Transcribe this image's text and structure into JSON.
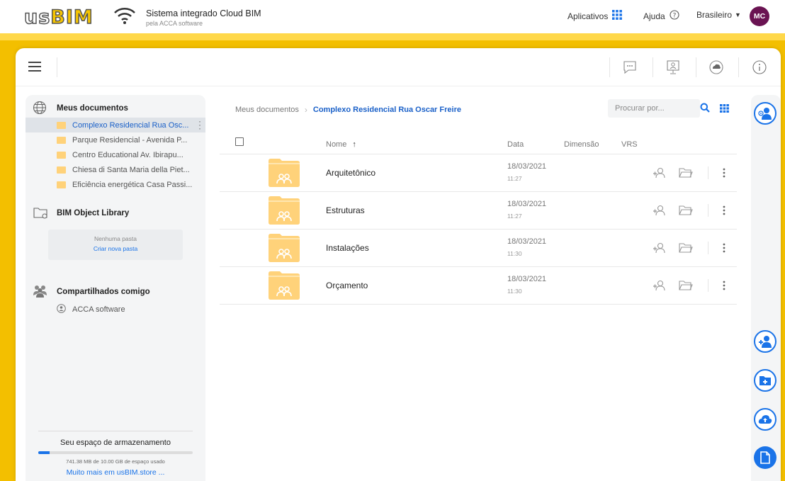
{
  "header": {
    "logo_us": "us",
    "logo_bim": "BIM",
    "title": "Sistema integrado Cloud BIM",
    "subtitle": "pela ACCA software",
    "apps_label": "Aplicativos",
    "help_label": "Ajuda",
    "language": "Brasileiro",
    "user_initials": "MC"
  },
  "sidebar": {
    "my_docs": {
      "title": "Meus documentos",
      "items": [
        {
          "label": "Complexo Residencial Rua Osc...",
          "active": true
        },
        {
          "label": "Parque Residencial - Avenida P..."
        },
        {
          "label": "Centro Educational Av. Ibirapu..."
        },
        {
          "label": "Chiesa di Santa Maria della Piet..."
        },
        {
          "label": "Eficiência energética Casa Passi..."
        }
      ]
    },
    "library": {
      "title": "BIM Object Library",
      "empty_text": "Nenhuma pasta",
      "create_link": "Criar nova pasta"
    },
    "shared": {
      "title": "Compartilhados comigo",
      "items": [
        {
          "label": "ACCA software"
        }
      ]
    },
    "storage": {
      "title": "Seu espaço de armazenamento",
      "used_text": "741.38 MB de 10.00 GB de espaço usado",
      "used_fraction": 0.074,
      "store_link": "Muito mais em usBIM.store ..."
    }
  },
  "main": {
    "breadcrumb": {
      "root": "Meus documentos",
      "current": "Complexo Residencial Rua Oscar Freire"
    },
    "search_placeholder": "Procurar por...",
    "columns": {
      "name": "Nome",
      "date": "Data",
      "dimension": "Dimensão",
      "vrs": "VRS"
    },
    "rows": [
      {
        "name": "Arquitetônico",
        "date": "18/03/2021",
        "time": "11:27"
      },
      {
        "name": "Estruturas",
        "date": "18/03/2021",
        "time": "11:27"
      },
      {
        "name": "Instalações",
        "date": "18/03/2021",
        "time": "11:30"
      },
      {
        "name": "Orçamento",
        "date": "18/03/2021",
        "time": "11:30"
      }
    ]
  },
  "colors": {
    "accent": "#1a73e8",
    "brand_yellow": "#f3bf00",
    "avatar": "#6a1352",
    "folder": "#ffd27a"
  }
}
